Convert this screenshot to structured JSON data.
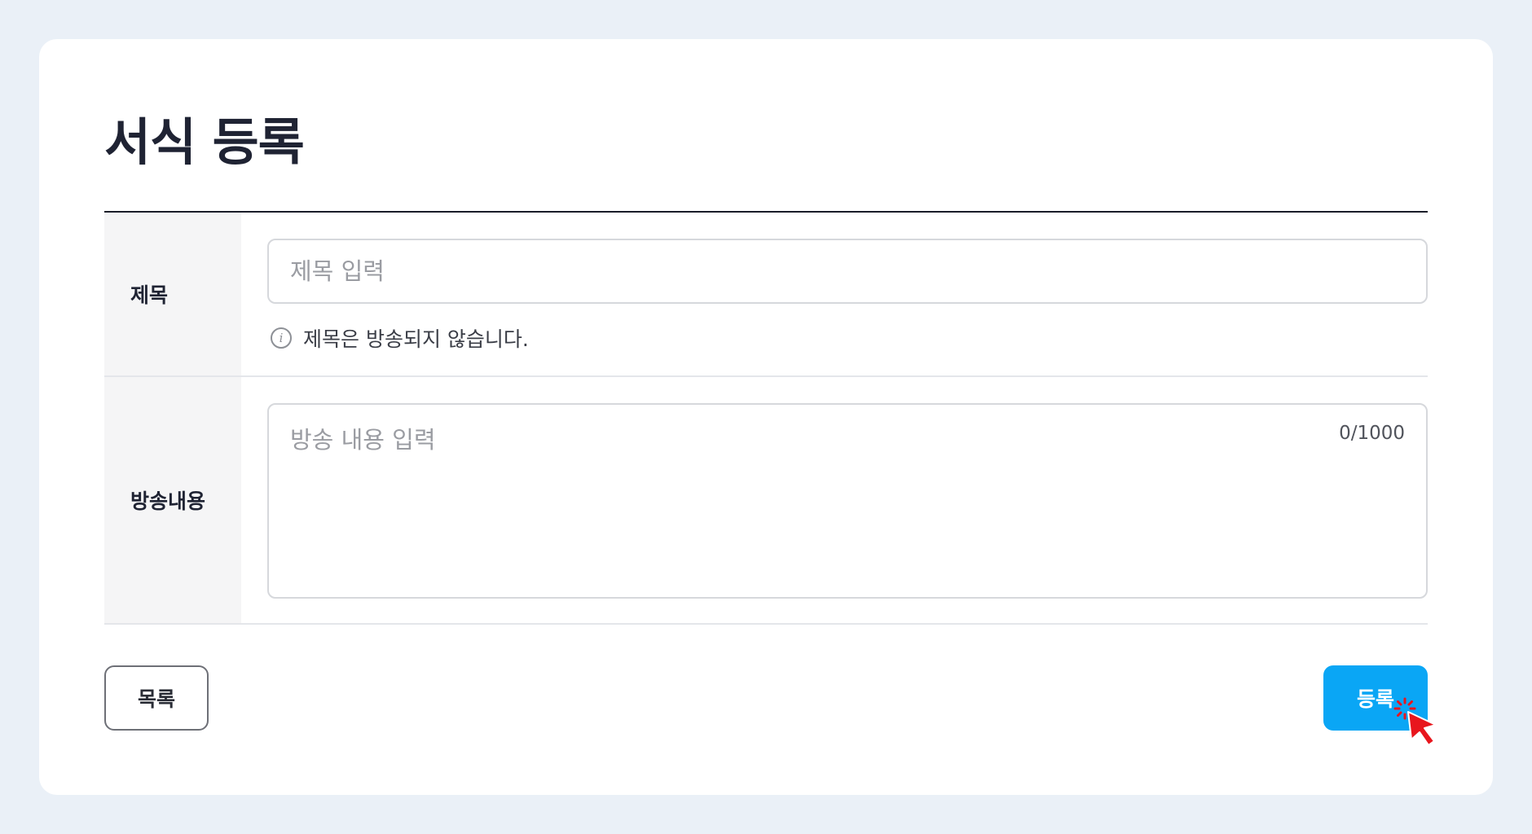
{
  "page": {
    "title": "서식 등록"
  },
  "form": {
    "title_row": {
      "label": "제목",
      "placeholder": "제목 입력",
      "value": "",
      "hint": "제목은 방송되지 않습니다."
    },
    "content_row": {
      "label": "방송내용",
      "placeholder": "방송 내용 입력",
      "value": "",
      "char_count": "0/1000"
    }
  },
  "actions": {
    "list_label": "목록",
    "submit_label": "등록"
  },
  "colors": {
    "accent": "#0aa6f5",
    "background": "#eaf0f7",
    "cursor": "#e8161d"
  },
  "icons": {
    "hint": "info-icon",
    "pointer": "click-cursor-icon"
  }
}
